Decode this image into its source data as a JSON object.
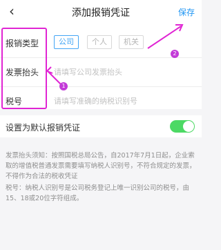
{
  "header": {
    "back_icon": "chevron-left-icon",
    "title": "添加报销凭证",
    "save_label": "保存"
  },
  "form": {
    "type_label": "报销类型",
    "type_options": [
      "公司",
      "个人",
      "机关"
    ],
    "type_selected": "公司",
    "invoice_title_label": "发票抬头",
    "invoice_title_placeholder": "请填写公司发票抬头",
    "tax_label": "税号",
    "tax_placeholder": "请填写准确的纳税识别号"
  },
  "default_toggle": {
    "label": "设置为默认报销凭证",
    "on": true
  },
  "notes": {
    "invoice_note": "发票抬头须知：按照国税总局公告，自2017年7月1日起，企业索取的增值税普通发票需要填写纳税人识别号，不符合规定的发票，不得作为合法的税收凭证",
    "tax_note": "税号：纳税人识别号是公司税务登记上唯一识别公司的税号，由15、18或20位字符组成。"
  },
  "annotations": {
    "marker_1": "1",
    "marker_2": "2",
    "color": "#e024d3"
  },
  "colors": {
    "accent": "#2196f3",
    "switch_on": "#4cd964"
  }
}
